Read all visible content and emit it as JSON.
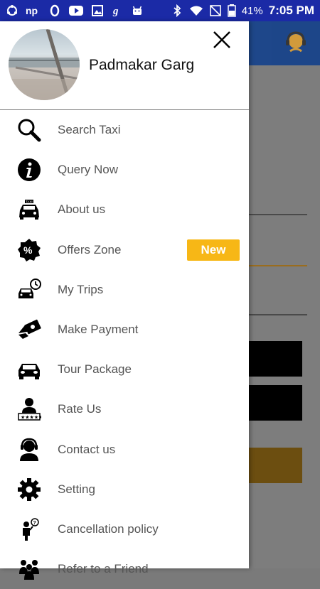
{
  "status_bar": {
    "left_icons": [
      "sync-icon",
      "np-icon",
      "opera-icon",
      "youtube-icon",
      "gallery-icon",
      "g-icon",
      "android-icon"
    ],
    "battery": "41%",
    "time": "7:05 PM"
  },
  "profile": {
    "name": "Padmakar Garg"
  },
  "menu": {
    "items": [
      {
        "label": "Search Taxi",
        "icon": "search-icon"
      },
      {
        "label": "Query Now",
        "icon": "info-icon"
      },
      {
        "label": "About us",
        "icon": "taxi-icon"
      },
      {
        "label": "Offers Zone",
        "icon": "percent-badge-icon",
        "badge": "New"
      },
      {
        "label": "My Trips",
        "icon": "trip-car-icon"
      },
      {
        "label": "Make Payment",
        "icon": "payment-icon"
      },
      {
        "label": "Tour Package",
        "icon": "car-icon"
      },
      {
        "label": "Rate Us",
        "icon": "rate-person-icon"
      },
      {
        "label": "Contact us",
        "icon": "headset-icon"
      },
      {
        "label": "Setting",
        "icon": "gear-icon"
      },
      {
        "label": "Cancellation policy",
        "icon": "question-person-icon"
      },
      {
        "label": "Refer to a Friend",
        "icon": "refer-people-icon"
      }
    ]
  },
  "colors": {
    "status_bar": "#1b2aa6",
    "badge": "#f7b716",
    "app_header": "#0d3d8c"
  }
}
